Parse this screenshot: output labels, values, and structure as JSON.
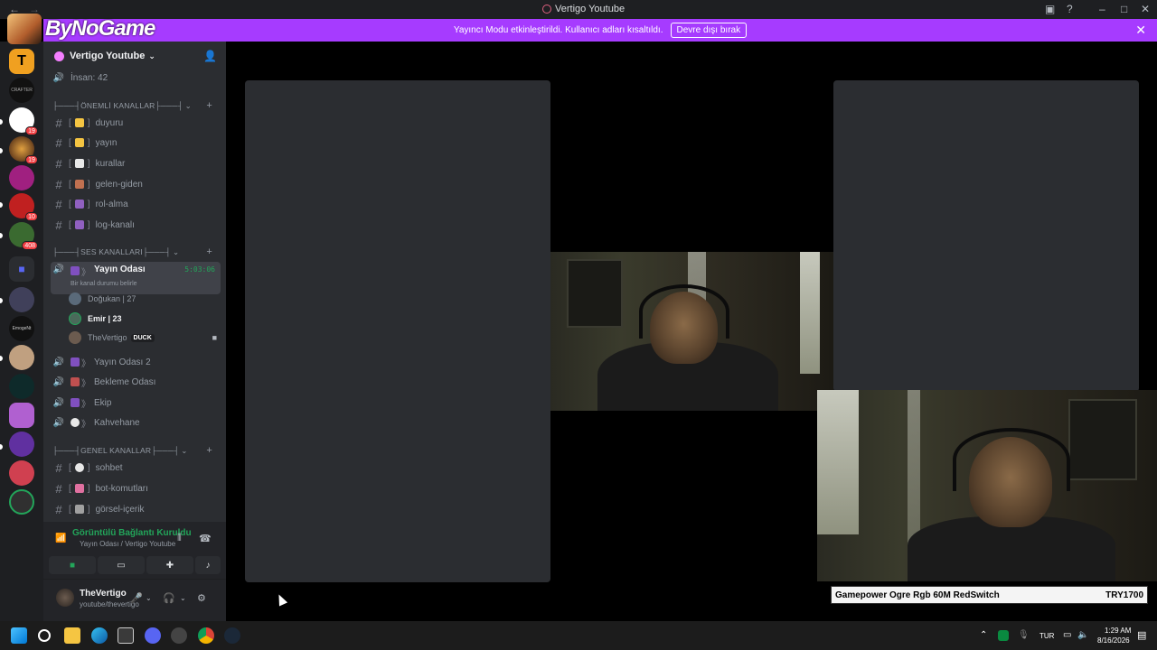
{
  "window": {
    "title": "Vertigo Youtube"
  },
  "overlay": {
    "logo_text": "ByNoGame"
  },
  "banner": {
    "message": "Yayıncı Modu etkinleştirildi. Kullanıcı adları kısaltıldı.",
    "button": "Devre dışı bırak"
  },
  "server": {
    "name": "Vertigo Youtube"
  },
  "server_badges": [
    "19",
    "19",
    "10",
    "408"
  ],
  "channels": {
    "top_voice": "İnsan: 42",
    "cat_important": "├───┤ÖNEMLİ KANALLAR├───┤",
    "important": [
      "duyuru",
      "yayın",
      "kurallar",
      "gelen-giden",
      "rol-alma",
      "log-kanalı"
    ],
    "cat_voice": "├───┤SES KANALLARI├───┤",
    "active_voice": {
      "name": "Yayın Odası",
      "timer": "5:03:06",
      "status_hint": "Bir kanal durumu belirle"
    },
    "voice_users": [
      {
        "name": "Doğukan | 27"
      },
      {
        "name": "Emir | 23"
      },
      {
        "name": "TheVertigo",
        "tag": "DUCK"
      }
    ],
    "voice": [
      "Yayın Odası 2",
      "Bekleme Odası",
      "Ekip",
      "Kahvehane"
    ],
    "cat_general": "├───┤GENEL KANALLAR├───┤",
    "general": [
      "sohbet",
      "bot-komutları",
      "görsel-içerik"
    ]
  },
  "voice_panel": {
    "status": "Görüntülü Bağlantı Kuruldu",
    "location": "Yayın Odası / Vertigo Youtube"
  },
  "user_panel": {
    "name": "TheVertigo",
    "status": "youtube/thevertigo"
  },
  "ticker": {
    "product": "Gamepower Ogre Rgb 60M RedSwitch",
    "price": "TRY1700"
  },
  "taskbar": {
    "lang": "TUR",
    "time": "1:29 AM",
    "date": "8/16/2026"
  }
}
